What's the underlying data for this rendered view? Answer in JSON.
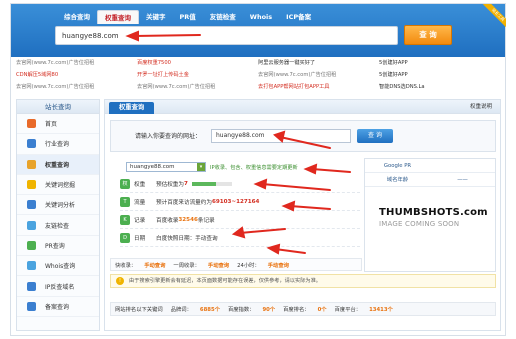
{
  "header": {
    "tabs": [
      "综合查询",
      "权重查询",
      "关键字",
      "PR值",
      "友链检查",
      "Whois",
      "ICP备案"
    ],
    "active_tab_index": 1,
    "corner_badge": "站长工具",
    "search_value": "huangye88.com",
    "search_button": "查 询"
  },
  "ads": [
    [
      "去官网(www.7c.com)广告位招租",
      "百度权重7500",
      "阿里云服务器一键买好了",
      "5创建好APP"
    ],
    [
      "CDN解压5域网80",
      "开罗一址打上传码土金",
      "去官网(www.7c.com)广告位招租",
      "5创建好APP"
    ],
    [
      "去官网(www.7c.com)广告位招租",
      "去官网(www.7c.com)广告位招租",
      "去打包APP帮网站打包APP工具",
      "智能DNS选DNS.La"
    ]
  ],
  "sidebar": {
    "title": "站长查询",
    "items": [
      {
        "label": "首页",
        "icon": "home-icon",
        "color": "#e86a2a"
      },
      {
        "label": "行业查询",
        "icon": "industry-icon",
        "color": "#3b7fd0"
      },
      {
        "label": "权重查询",
        "icon": "paw-icon",
        "color": "#e8a32a"
      },
      {
        "label": "关键词挖掘",
        "icon": "keyword-icon",
        "color": "#f0b400"
      },
      {
        "label": "关键词分析",
        "icon": "analysis-icon",
        "color": "#3b7fd0"
      },
      {
        "label": "友链检查",
        "icon": "link-icon",
        "color": "#4aa3df"
      },
      {
        "label": "PR查询",
        "icon": "pr-icon",
        "color": "#4caf50"
      },
      {
        "label": "Whois查询",
        "icon": "whois-icon",
        "color": "#4aa3df"
      },
      {
        "label": "IP反查域名",
        "icon": "ip-icon",
        "color": "#3b7fd0"
      },
      {
        "label": "备案查询",
        "icon": "icp-icon",
        "color": "#3b7fd0"
      }
    ],
    "active_index": 2
  },
  "main": {
    "tab_label": "权重查询",
    "right_link": "权重说明",
    "query_label": "请输入你要查询的网址：",
    "query_value": "huangye88.com",
    "query_button": "查 询",
    "domain_select": "huangye88.com",
    "domain_note": "IP收录、包含、权重信息需要定期更新",
    "rows": [
      {
        "badge": "权",
        "badge_color": "#4caf50",
        "key": "权重",
        "value_prefix": "预估权重为",
        "value_hl": "7"
      },
      {
        "badge": "T",
        "badge_color": "#4caf50",
        "key": "流量",
        "value_prefix": "预计百度来访流量约为",
        "value_hl": "69103~127164"
      },
      {
        "badge": "K",
        "badge_color": "#4caf50",
        "key": "记录",
        "value_prefix": "百度收录",
        "value_hl": "32546",
        "value_suffix": "条记录"
      },
      {
        "badge": "D",
        "badge_color": "#4caf50",
        "key": "日期",
        "value_prefix": "白度快照日期：",
        "value_hl": "手动查询"
      }
    ],
    "rank_row": [
      "快收录：",
      "手动查询",
      "一周收录：",
      "手动查询",
      "24小时：",
      "手动查询"
    ],
    "notice": "由于搜索引擎更新会有延迟，本页面数据可能存在误差，仅供参考，请以实际为准。",
    "stats_row": [
      "网站排名以下关键词",
      "",
      "品牌词：",
      "6885个",
      "百度指数：",
      "90个",
      "百度排名：",
      "0个",
      "百度平台：",
      "13413个"
    ],
    "right_box": {
      "google_pr_label": "Google PR",
      "google_pr_value": "",
      "alexa_label": "域名年龄",
      "alexa_value": "——",
      "thumb_title": "THUMBSHOTS.com",
      "thumb_sub": "IMAGE COMING SOON"
    },
    "pr_fill": 0.6
  }
}
